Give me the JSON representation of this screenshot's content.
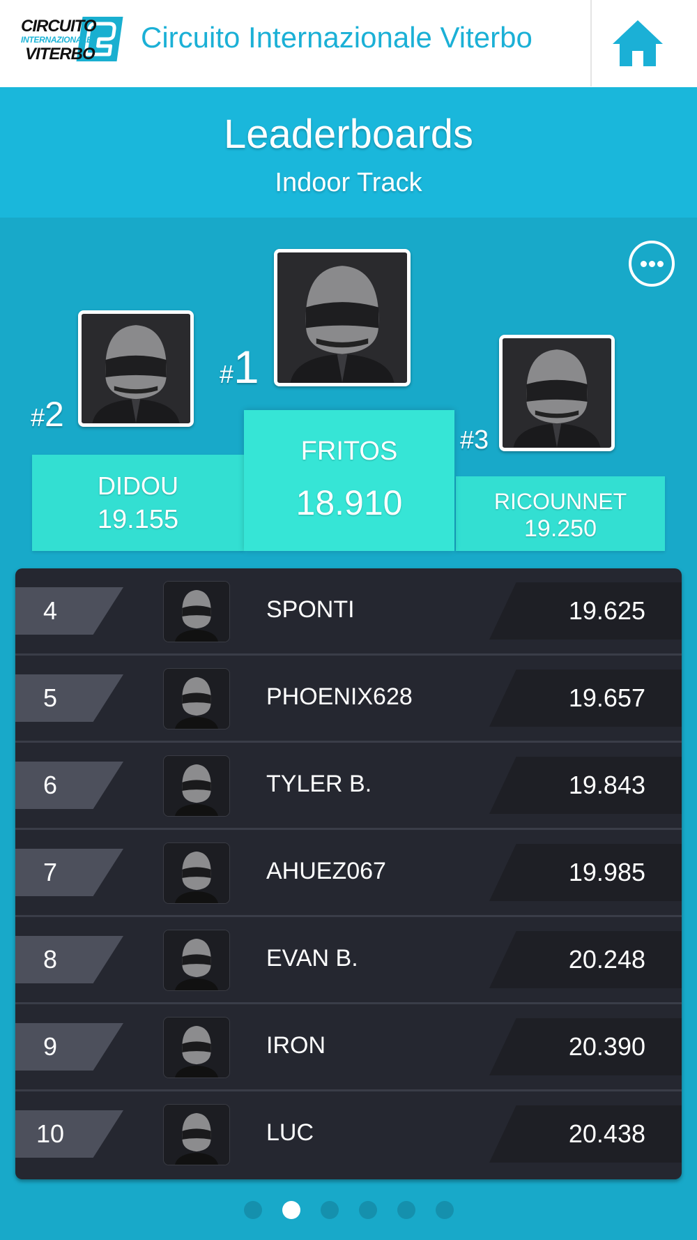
{
  "header": {
    "logo_lines": [
      "CIRCUITO",
      "INTERNAZIONALE",
      "VITERBO"
    ],
    "site_title": "Circuito Internazionale Viterbo",
    "home_icon": "home-icon"
  },
  "page": {
    "title": "Leaderboards",
    "subtitle": "Indoor Track",
    "more_icon": "more-options-icon"
  },
  "podium": {
    "first": {
      "rank_prefix": "#",
      "rank": "1",
      "name": "FRITOS",
      "time": "18.910"
    },
    "second": {
      "rank_prefix": "#",
      "rank": "2",
      "name": "DIDOU",
      "time": "19.155"
    },
    "third": {
      "rank_prefix": "#",
      "rank": "3",
      "name": "RICOUNNET",
      "time": "19.250"
    }
  },
  "leaderboard": [
    {
      "rank": "4",
      "name": "SPONTI",
      "time": "19.625"
    },
    {
      "rank": "5",
      "name": "PHOENIX628",
      "time": "19.657"
    },
    {
      "rank": "6",
      "name": "TYLER B.",
      "time": "19.843"
    },
    {
      "rank": "7",
      "name": "AHUEZ067",
      "time": "19.985"
    },
    {
      "rank": "8",
      "name": "EVAN B.",
      "time": "20.248"
    },
    {
      "rank": "9",
      "name": "IRON",
      "time": "20.390"
    },
    {
      "rank": "10",
      "name": "LUC",
      "time": "20.438"
    }
  ],
  "pagination": {
    "pages": 6,
    "active_page": 2
  },
  "colors": {
    "brand_blue": "#1bb0d6",
    "background": "#18a9c9",
    "podium_teal": "#33dfd2",
    "list_dark": "#252730"
  }
}
